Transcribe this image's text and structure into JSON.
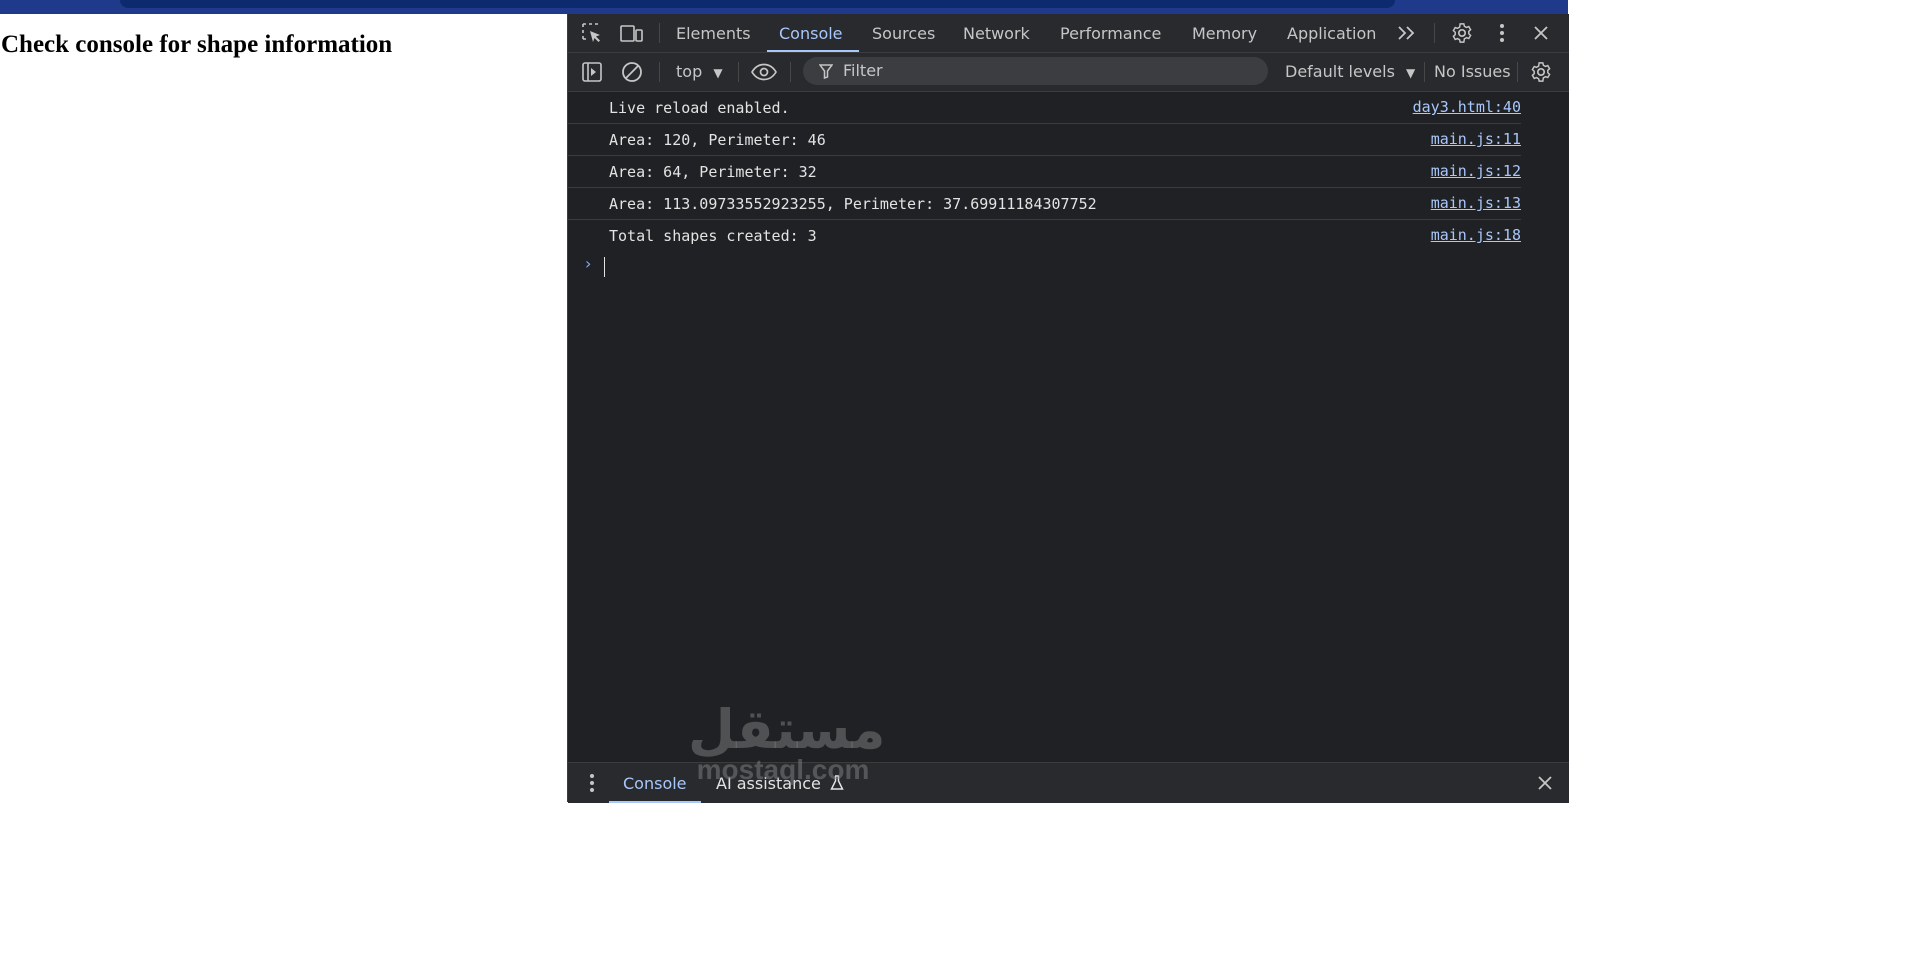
{
  "page": {
    "heading": "Check console for shape information"
  },
  "devtools": {
    "tabs": [
      "Elements",
      "Console",
      "Sources",
      "Network",
      "Performance",
      "Memory",
      "Application"
    ],
    "active_tab": "Console",
    "toolbar": {
      "context": "top",
      "filter_placeholder": "Filter",
      "levels": "Default levels",
      "issues": "No Issues"
    },
    "console_rows": [
      {
        "message": "Live reload enabled.",
        "source": "day3.html:40"
      },
      {
        "message": "Area: 120, Perimeter: 46",
        "source": "main.js:11"
      },
      {
        "message": "Area: 64, Perimeter: 32",
        "source": "main.js:12"
      },
      {
        "message": "Area: 113.09733552923255, Perimeter: 37.69911184307752",
        "source": "main.js:13"
      },
      {
        "message": "Total shapes created: 3",
        "source": "main.js:18"
      }
    ],
    "drawer": {
      "tab1": "Console",
      "tab2": "AI assistance"
    }
  },
  "watermark": {
    "arabic": "مستقل",
    "latin": "mostaql.com"
  },
  "colors": {
    "accent": "#a8c7fa",
    "panel_bg": "#202124",
    "link": "#a8c7fa"
  },
  "icons": [
    "inspect-icon",
    "device-toggle-icon",
    "more-tabs-icon",
    "settings-gear-icon",
    "kebab-menu-icon",
    "close-icon",
    "sidebar-toggle-icon",
    "clear-console-icon",
    "eye-icon",
    "filter-funnel-icon",
    "console-settings-icon",
    "flask-icon"
  ]
}
